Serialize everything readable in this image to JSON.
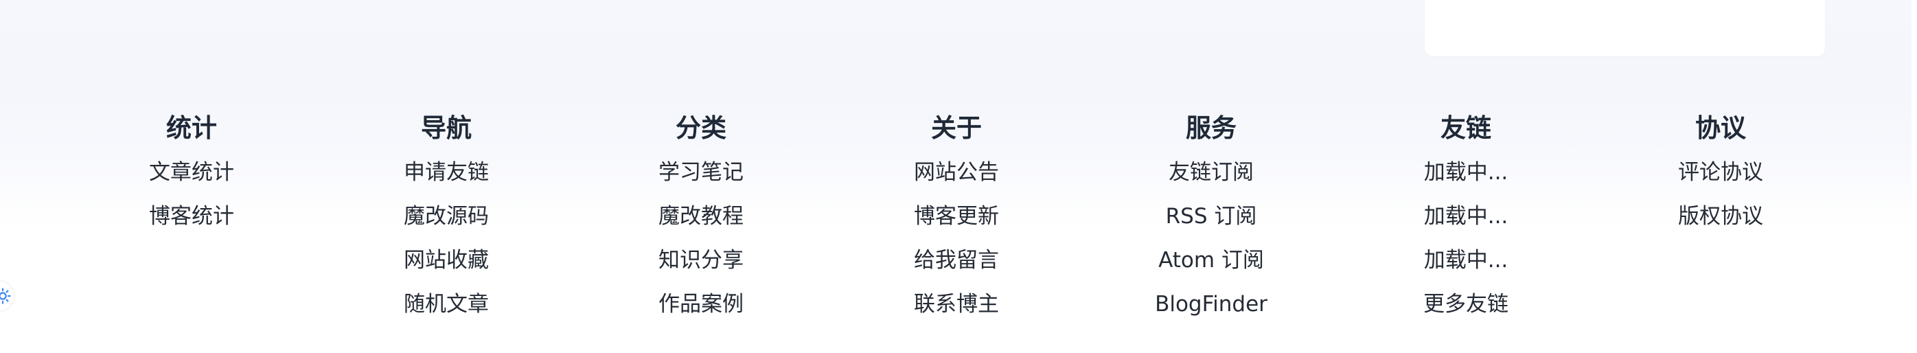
{
  "footer": {
    "columns": [
      {
        "title": "统计",
        "links": [
          "文章统计",
          "博客统计"
        ]
      },
      {
        "title": "导航",
        "links": [
          "申请友链",
          "魔改源码",
          "网站收藏",
          "随机文章"
        ]
      },
      {
        "title": "分类",
        "links": [
          "学习笔记",
          "魔改教程",
          "知识分享",
          "作品案例"
        ]
      },
      {
        "title": "关于",
        "links": [
          "网站公告",
          "博客更新",
          "给我留言",
          "联系博主"
        ]
      },
      {
        "title": "服务",
        "links": [
          "友链订阅",
          "RSS 订阅",
          "Atom 订阅",
          "BlogFinder"
        ]
      },
      {
        "title": "友链",
        "links": [
          "加载中...",
          "加载中...",
          "加载中...",
          "更多友链"
        ]
      },
      {
        "title": "协议",
        "links": [
          "评论协议",
          "版权协议"
        ]
      }
    ]
  },
  "icons": {
    "theme_toggle": "sun-icon"
  },
  "colors": {
    "title": "#1f2937",
    "link": "#252b35",
    "sun": "#3b82f6"
  }
}
